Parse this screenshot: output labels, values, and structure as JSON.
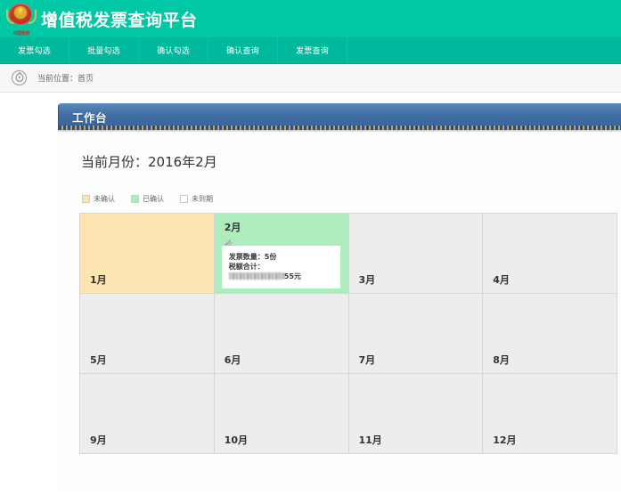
{
  "header": {
    "title": "增值税发票查询平台",
    "emblem_text": "中国税务",
    "emblem_icon": "national-emblem-icon",
    "bg_color": "#00c8a5"
  },
  "nav": {
    "bg_color": "#00b89c",
    "items": [
      {
        "label": "发票勾选"
      },
      {
        "label": "批量勾选"
      },
      {
        "label": "确认勾选"
      },
      {
        "label": "确认查询"
      },
      {
        "label": "发票查询"
      }
    ]
  },
  "breadcrumb": {
    "icon": "location-pin-icon",
    "text": "当前位置：首页"
  },
  "panel": {
    "title": "工作台",
    "header_color": "#3f6da3"
  },
  "workbench": {
    "current_month_label": "当前月份：2016年2月",
    "legend": [
      {
        "label": "未确认",
        "color": "#fbe5b0"
      },
      {
        "label": "已确认",
        "color": "#acecbd"
      },
      {
        "label": "未到期",
        "color": "#ffffff"
      }
    ],
    "detail": {
      "clip_icon": "paperclip-icon",
      "invoice_count_line": "发票数量：5份",
      "tax_total_line": "税额合计：",
      "tax_amount_masked": "██████████",
      "tax_amount_suffix": "55元"
    },
    "months": [
      {
        "label": "1月",
        "state": "unconfirmed"
      },
      {
        "label": "2月",
        "state": "confirmed"
      },
      {
        "label": "3月",
        "state": "pending"
      },
      {
        "label": "4月",
        "state": "pending"
      },
      {
        "label": "5月",
        "state": "pending"
      },
      {
        "label": "6月",
        "state": "pending"
      },
      {
        "label": "7月",
        "state": "pending"
      },
      {
        "label": "8月",
        "state": "pending"
      },
      {
        "label": "9月",
        "state": "pending"
      },
      {
        "label": "10月",
        "state": "pending"
      },
      {
        "label": "11月",
        "state": "pending"
      },
      {
        "label": "12月",
        "state": "pending"
      }
    ]
  }
}
